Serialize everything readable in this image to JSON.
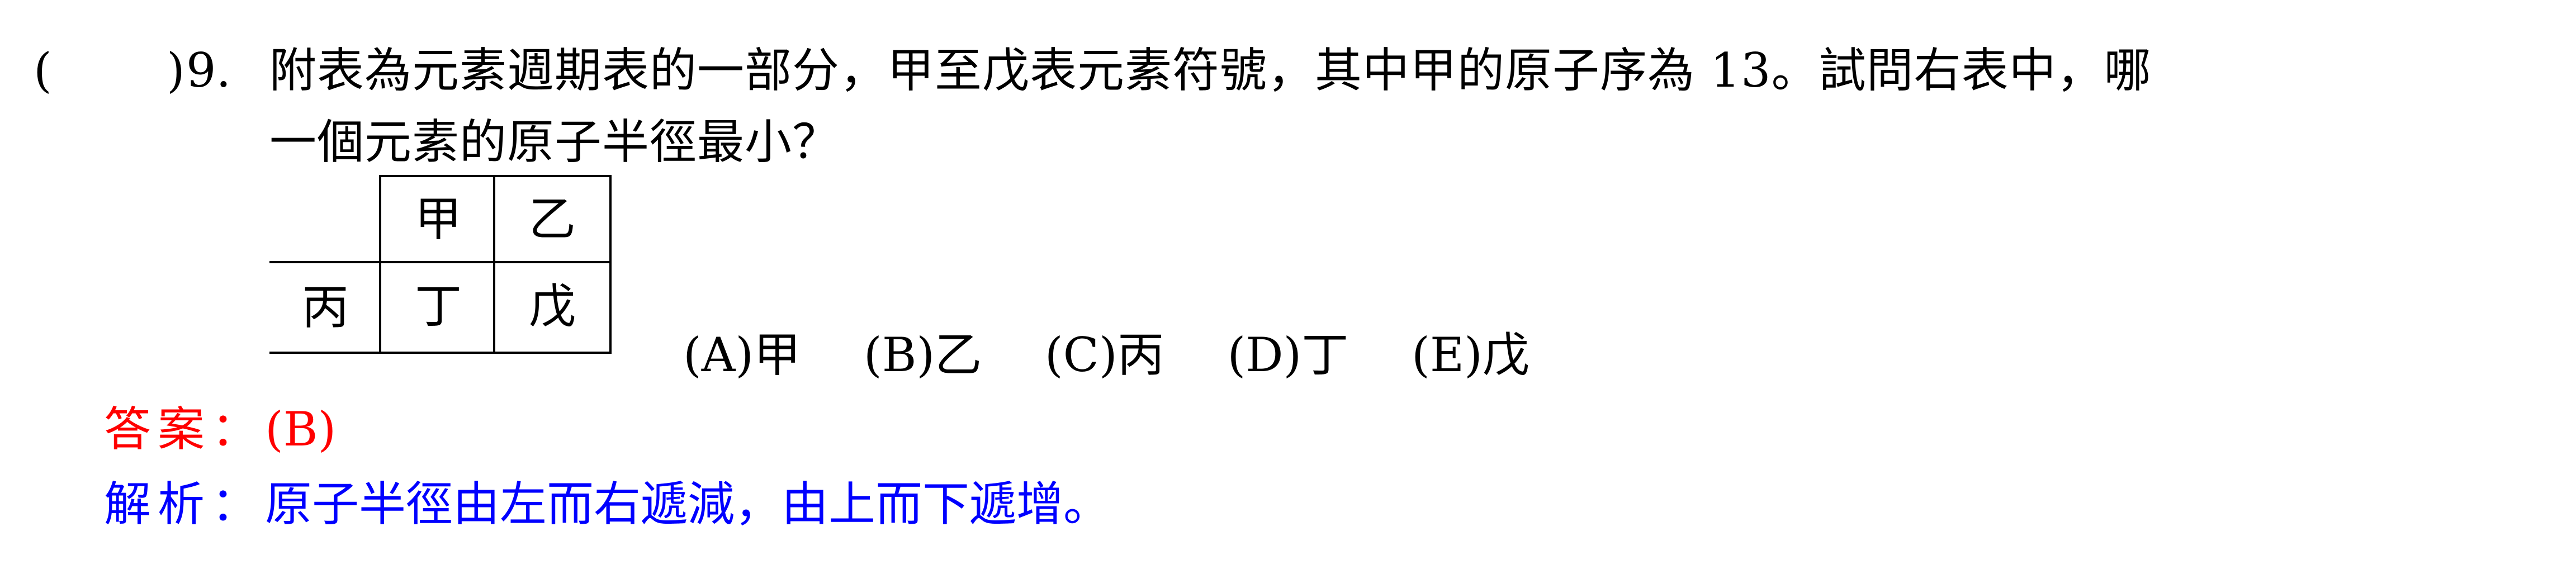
{
  "question": {
    "paren_open": "(",
    "paren_close": ")",
    "number": "9.",
    "line1": "附表為元素週期表的一部分，甲至戊表元素符號，其中甲的原子序為 13。試問右表中，哪",
    "line2": "一個元素的原子半徑最小？"
  },
  "table": {
    "row1": [
      "甲",
      "乙"
    ],
    "row2": [
      "丙",
      "丁",
      "戊"
    ]
  },
  "options": [
    "(A)甲",
    "(B)乙",
    "(C)丙",
    "(D)丁",
    "(E)戊"
  ],
  "answer": {
    "label": "答案：",
    "value": "(B)",
    "color": "#ff0000"
  },
  "explanation": {
    "label": "解析：",
    "text": "原子半徑由左而右遞減，由上而下遞增。",
    "color": "#0000ff"
  }
}
